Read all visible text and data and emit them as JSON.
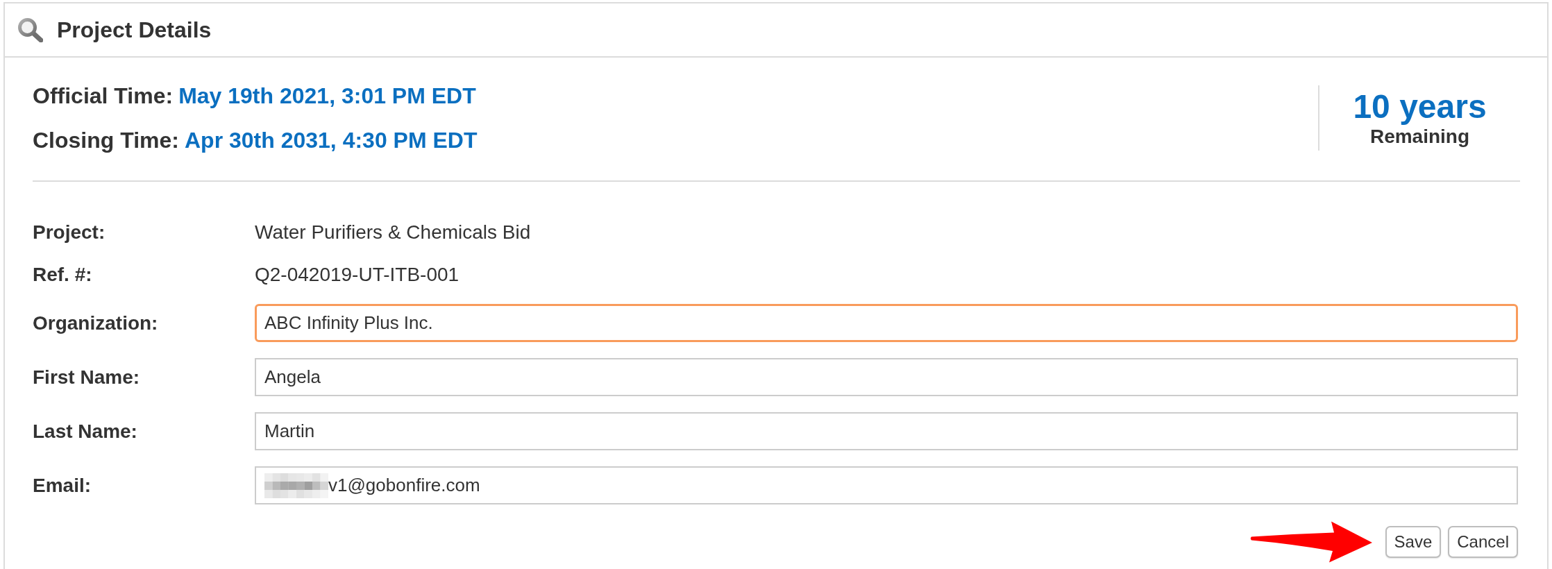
{
  "panel": {
    "title": "Project Details"
  },
  "times": [
    {
      "label": "Official Time:",
      "value": "May 19th 2021, 3:01 PM EDT"
    },
    {
      "label": "Closing Time:",
      "value": "Apr 30th 2031, 4:30 PM EDT"
    }
  ],
  "remaining": {
    "amount": "10 years",
    "label": "Remaining"
  },
  "fields": [
    {
      "kind": "text",
      "label": "Project:",
      "value": "Water Purifiers & Chemicals Bid"
    },
    {
      "kind": "text",
      "label": "Ref. #:",
      "value": "Q2-042019-UT-ITB-001"
    },
    {
      "kind": "input",
      "label": "Organization:",
      "value": "ABC Infinity Plus Inc.",
      "focused": true,
      "redacted": false
    },
    {
      "kind": "input",
      "label": "First Name:",
      "value": "Angela",
      "focused": false,
      "redacted": false
    },
    {
      "kind": "input",
      "label": "Last Name:",
      "value": "Martin",
      "focused": false,
      "redacted": false
    },
    {
      "kind": "input",
      "label": "Email:",
      "value": "v1@gobonfire.com",
      "focused": false,
      "redacted": true
    }
  ],
  "buttons": [
    {
      "label": "Save"
    },
    {
      "label": "Cancel"
    }
  ]
}
